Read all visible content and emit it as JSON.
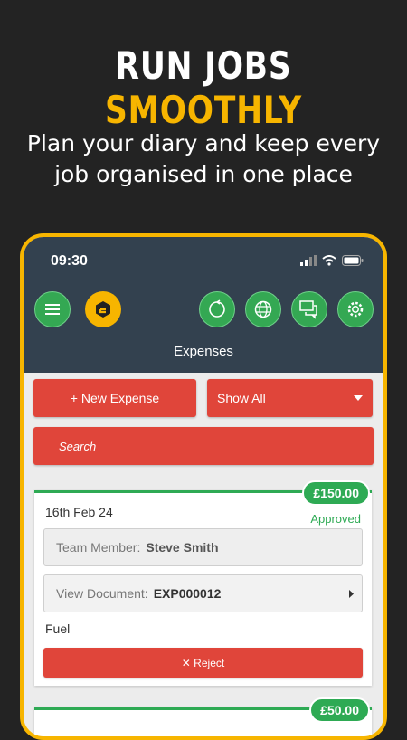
{
  "promo": {
    "headline_white": "RUN JOBS",
    "headline_yellow": "SMOOTHLY",
    "subline_1": "Plan your diary and keep every",
    "subline_2": "job organised in one place"
  },
  "status_bar": {
    "time": "09:30"
  },
  "app": {
    "title": "Expenses",
    "new_expense_label": "+ New Expense",
    "filter_selected": "Show All",
    "search_placeholder": "Search"
  },
  "expenses": [
    {
      "amount": "£150.00",
      "date": "16th Feb 24",
      "status": "Approved",
      "team_member_label": "Team Member:",
      "team_member": "Steve Smith",
      "document_label": "View Document:",
      "document": "EXP000012",
      "category": "Fuel",
      "reject_label": "✕ Reject"
    },
    {
      "amount": "£50.00"
    }
  ],
  "colors": {
    "background": "#232323",
    "accent_yellow": "#f7b500",
    "header_navy": "#33414f",
    "button_red": "#e0453a",
    "green": "#2eaa54"
  }
}
